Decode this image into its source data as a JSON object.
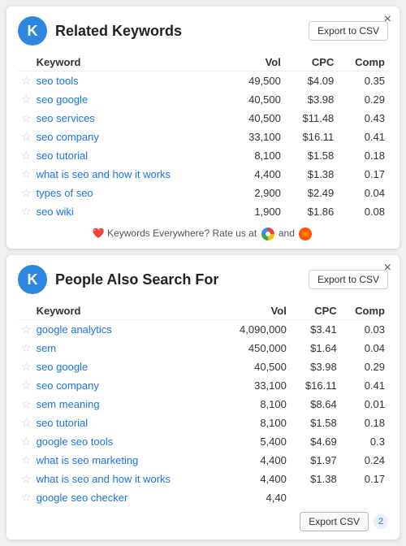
{
  "card1": {
    "logo": "K",
    "title": "Related Keywords",
    "export_label": "Export to CSV",
    "close_label": "×",
    "columns": [
      "Keyword",
      "Vol",
      "CPC",
      "Comp"
    ],
    "rows": [
      {
        "keyword": "seo tools",
        "vol": "49,500",
        "cpc": "$4.09",
        "comp": "0.35"
      },
      {
        "keyword": "seo google",
        "vol": "40,500",
        "cpc": "$3.98",
        "comp": "0.29"
      },
      {
        "keyword": "seo services",
        "vol": "40,500",
        "cpc": "$11.48",
        "comp": "0.43"
      },
      {
        "keyword": "seo company",
        "vol": "33,100",
        "cpc": "$16.11",
        "comp": "0.41"
      },
      {
        "keyword": "seo tutorial",
        "vol": "8,100",
        "cpc": "$1.58",
        "comp": "0.18"
      },
      {
        "keyword": "what is seo and how it works",
        "vol": "4,400",
        "cpc": "$1.38",
        "comp": "0.17"
      },
      {
        "keyword": "types of seo",
        "vol": "2,900",
        "cpc": "$2.49",
        "comp": "0.04"
      },
      {
        "keyword": "seo wiki",
        "vol": "1,900",
        "cpc": "$1.86",
        "comp": "0.08"
      }
    ],
    "rate_text": "Keywords Everywhere? Rate us at",
    "rate_and": "and"
  },
  "card2": {
    "logo": "K",
    "title": "People Also Search For",
    "export_label": "Export to CSV",
    "export_badge": "2",
    "close_label": "×",
    "columns": [
      "Keyword",
      "Vol",
      "CPC",
      "Comp"
    ],
    "rows": [
      {
        "keyword": "google analytics",
        "vol": "4,090,000",
        "cpc": "$3.41",
        "comp": "0.03"
      },
      {
        "keyword": "sem",
        "vol": "450,000",
        "cpc": "$1.64",
        "comp": "0.04"
      },
      {
        "keyword": "seo google",
        "vol": "40,500",
        "cpc": "$3.98",
        "comp": "0.29"
      },
      {
        "keyword": "seo company",
        "vol": "33,100",
        "cpc": "$16.11",
        "comp": "0.41"
      },
      {
        "keyword": "sem meaning",
        "vol": "8,100",
        "cpc": "$8.64",
        "comp": "0.01"
      },
      {
        "keyword": "seo tutorial",
        "vol": "8,100",
        "cpc": "$1.58",
        "comp": "0.18"
      },
      {
        "keyword": "google seo tools",
        "vol": "5,400",
        "cpc": "$4.69",
        "comp": "0.3"
      },
      {
        "keyword": "what is seo marketing",
        "vol": "4,400",
        "cpc": "$1.97",
        "comp": "0.24"
      },
      {
        "keyword": "what is seo and how it works",
        "vol": "4,400",
        "cpc": "$1.38",
        "comp": "0.17"
      },
      {
        "keyword": "google seo checker",
        "vol": "4,40",
        "cpc": "",
        "comp": ""
      }
    ]
  }
}
